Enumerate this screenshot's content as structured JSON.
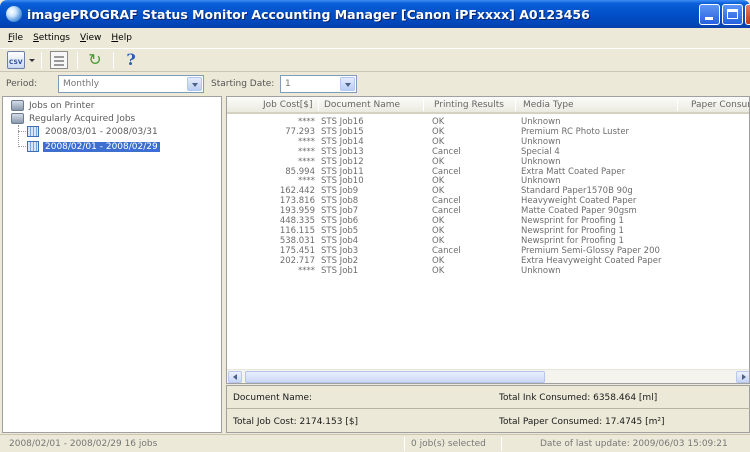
{
  "window": {
    "title": "imagePROGRAF Status Monitor Accounting Manager [Canon iPFxxxx]  A0123456"
  },
  "menu": [
    "File",
    "Settings",
    "View",
    "Help"
  ],
  "toolbar": {
    "icons": [
      "csv-export-icon",
      "chevron-down-icon",
      "properties-icon",
      "refresh-icon",
      "help-icon"
    ],
    "csv_label": "CSV"
  },
  "period": {
    "label": "Period:",
    "value": "Monthly",
    "start_label": "Starting Date:",
    "start_value": "1"
  },
  "tree": {
    "jobs_on_printer": "Jobs on Printer",
    "regular": "Regularly Acquired Jobs",
    "ranges": [
      "2008/03/01 - 2008/03/31",
      "2008/02/01 - 2008/02/29"
    ],
    "selected_index": 1
  },
  "table": {
    "columns": [
      "Job Cost[$]",
      "Document Name",
      "Printing Results",
      "Media Type",
      "Paper Consum"
    ],
    "rows": [
      {
        "cost": "****",
        "doc": "STS Job16",
        "result": "OK",
        "media": "Unknown"
      },
      {
        "cost": "77.293",
        "doc": "STS Job15",
        "result": "OK",
        "media": "Premium RC Photo Luster"
      },
      {
        "cost": "****",
        "doc": "STS Job14",
        "result": "OK",
        "media": "Unknown"
      },
      {
        "cost": "****",
        "doc": "STS Job13",
        "result": "Cancel",
        "media": "Special 4"
      },
      {
        "cost": "****",
        "doc": "STS Job12",
        "result": "OK",
        "media": "Unknown"
      },
      {
        "cost": "85.994",
        "doc": "STS Job11",
        "result": "Cancel",
        "media": "Extra Matt Coated Paper"
      },
      {
        "cost": "****",
        "doc": "STS Job10",
        "result": "OK",
        "media": "Unknown"
      },
      {
        "cost": "162.442",
        "doc": "STS Job9",
        "result": "OK",
        "media": "Standard Paper1570B 90g"
      },
      {
        "cost": "173.816",
        "doc": "STS Job8",
        "result": "Cancel",
        "media": "Heavyweight Coated Paper"
      },
      {
        "cost": "193.959",
        "doc": "STS Job7",
        "result": "Cancel",
        "media": "Matte Coated Paper 90gsm"
      },
      {
        "cost": "448.335",
        "doc": "STS Job6",
        "result": "OK",
        "media": "Newsprint for Proofing 1"
      },
      {
        "cost": "116.115",
        "doc": "STS Job5",
        "result": "OK",
        "media": "Newsprint for Proofing 1"
      },
      {
        "cost": "538.031",
        "doc": "STS Job4",
        "result": "OK",
        "media": "Newsprint for Proofing 1"
      },
      {
        "cost": "175.451",
        "doc": "STS Job3",
        "result": "Cancel",
        "media": "Premium Semi-Glossy Paper 200"
      },
      {
        "cost": "202.717",
        "doc": "STS Job2",
        "result": "OK",
        "media": "Extra Heavyweight Coated Paper"
      },
      {
        "cost": "****",
        "doc": "STS Job1",
        "result": "OK",
        "media": "Unknown"
      }
    ]
  },
  "summary": {
    "document_name": "Document Name:",
    "total_ink": "Total Ink Consumed: 6358.464 [ml]",
    "total_cost": "Total Job Cost: 2174.153 [$]",
    "total_paper": "Total Paper Consumed: 17.4745 [m²]"
  },
  "status": {
    "left": "2008/02/01 - 2008/02/29  16 jobs",
    "selected": "0 job(s) selected",
    "last_update": "Date of last update: 2009/06/03 15:09:21"
  },
  "colors": {
    "title_bar": "#0250c8",
    "selection": "#3d6fd1",
    "window_bg": "#ece9d8"
  }
}
